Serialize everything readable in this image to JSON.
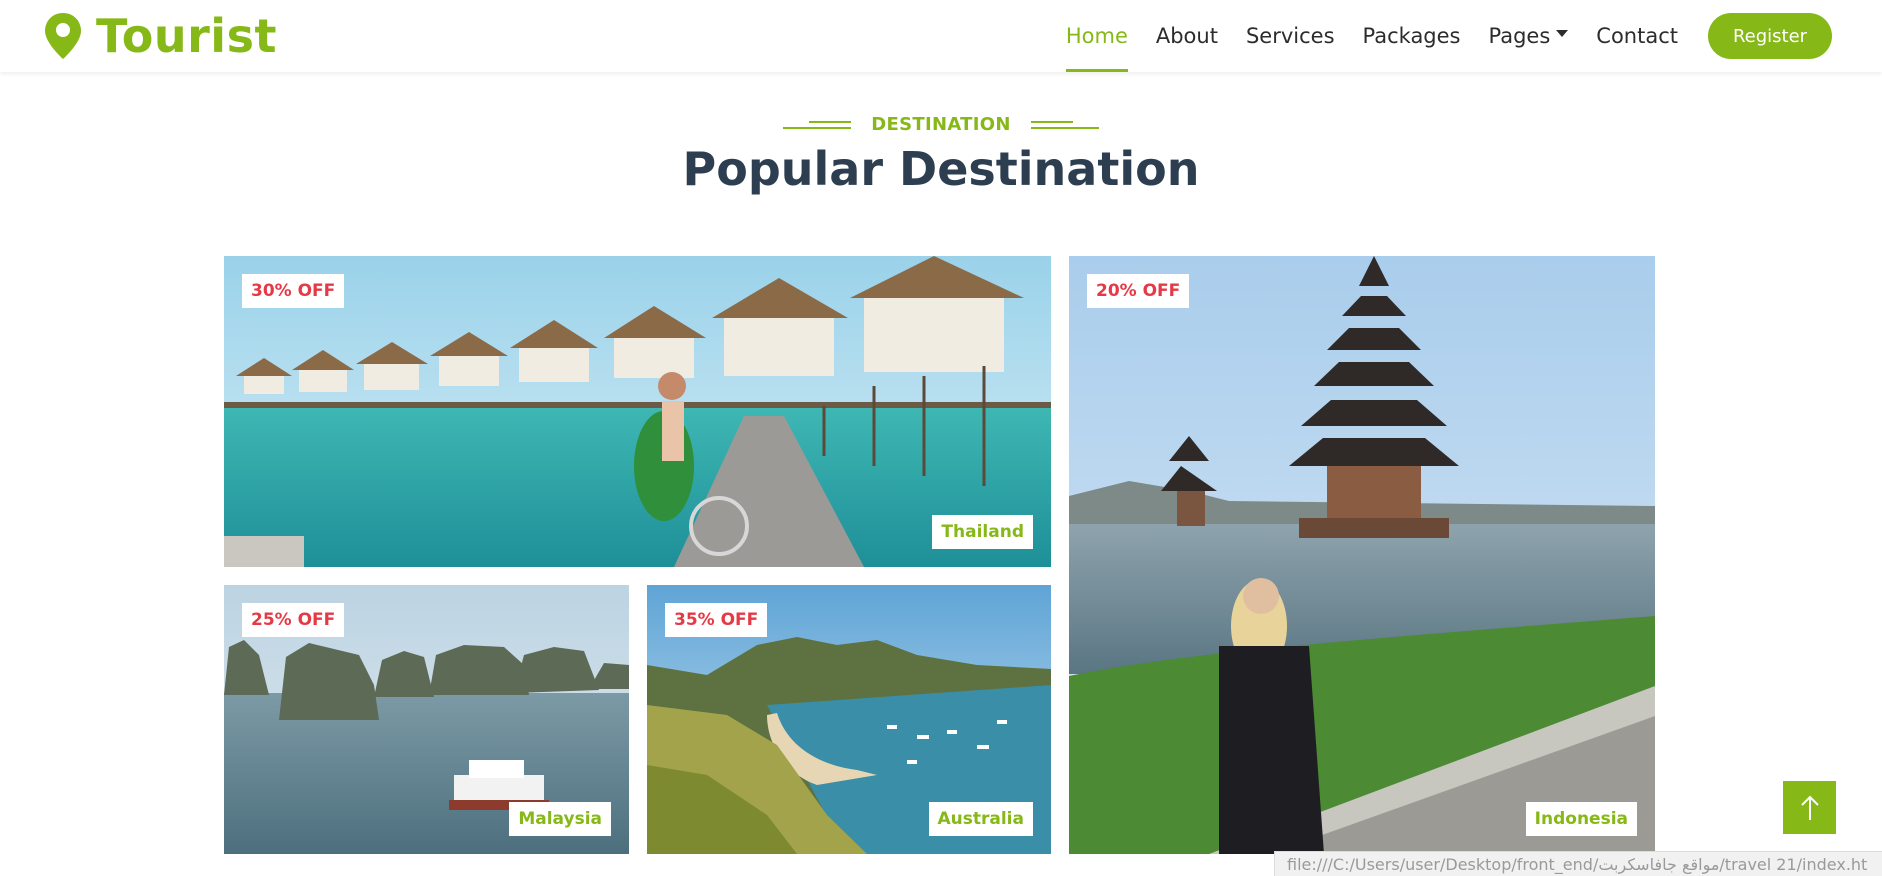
{
  "brand": {
    "name": "Tourist",
    "icon": "map-marker-icon",
    "color": "#86b817"
  },
  "nav": {
    "items": [
      {
        "label": "Home",
        "active": true
      },
      {
        "label": "About"
      },
      {
        "label": "Services"
      },
      {
        "label": "Packages"
      },
      {
        "label": "Pages",
        "dropdown": true
      },
      {
        "label": "Contact"
      }
    ],
    "register_label": "Register"
  },
  "section": {
    "subtitle": "DESTINATION",
    "title": "Popular Destination"
  },
  "destinations": [
    {
      "name": "Thailand",
      "discount": "30% OFF"
    },
    {
      "name": "Malaysia",
      "discount": "25% OFF"
    },
    {
      "name": "Australia",
      "discount": "35% OFF"
    },
    {
      "name": "Indonesia",
      "discount": "20% OFF"
    }
  ],
  "back_to_top": {
    "icon": "arrow-up-icon"
  },
  "status_bar": {
    "url": "file:///C:/Users/user/Desktop/front_end/مواقع جافاسكربت/travel 21/index.ht"
  },
  "colors": {
    "accent": "#86b817",
    "discount": "#e63946",
    "heading": "#2c3e50"
  }
}
